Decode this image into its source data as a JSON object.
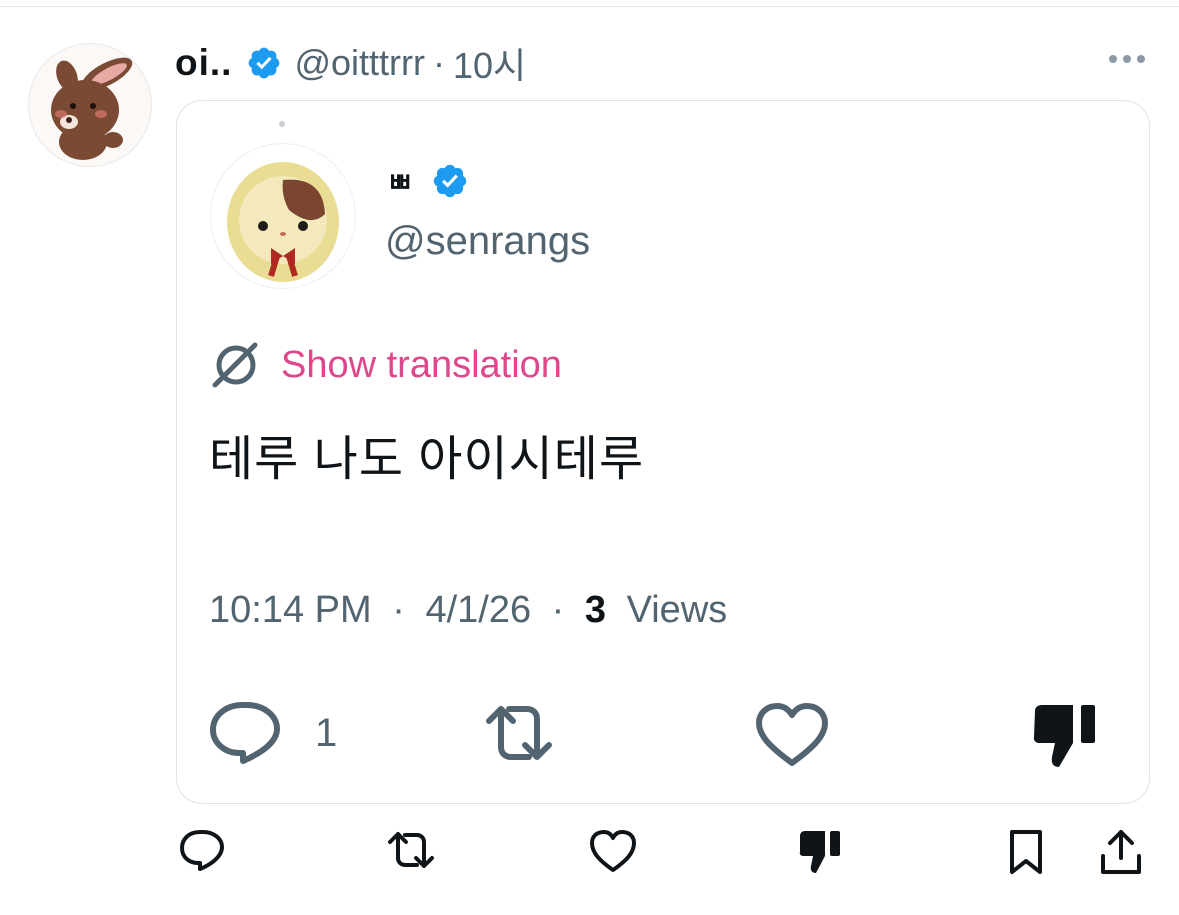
{
  "post": {
    "display_name": "oi..",
    "handle": "@oitttrrr",
    "separator": "·",
    "time": "10시"
  },
  "quote": {
    "display_name": "ㅃ",
    "handle": "@senrangs",
    "translate_label": "Show translation",
    "text": "테루 나도 아이시테루",
    "timestamp_time": "10:14 PM",
    "timestamp_date": "4/1/26",
    "separator": "·",
    "views_count": "3",
    "views_label": "Views",
    "reply_count": "1"
  },
  "colors": {
    "accent_pink": "#e0468b",
    "verified_blue": "#1d9bf0",
    "muted_text": "#536471",
    "primary_text": "#0f1419"
  },
  "icons": {
    "header": [
      "verified-badge-icon",
      "more-icon"
    ],
    "quote_actions": [
      "reply-icon",
      "repost-icon",
      "like-icon",
      "dislike-icon"
    ],
    "post_actions": [
      "reply-icon",
      "repost-icon",
      "like-icon",
      "dislike-icon",
      "bookmark-icon",
      "share-icon"
    ]
  }
}
